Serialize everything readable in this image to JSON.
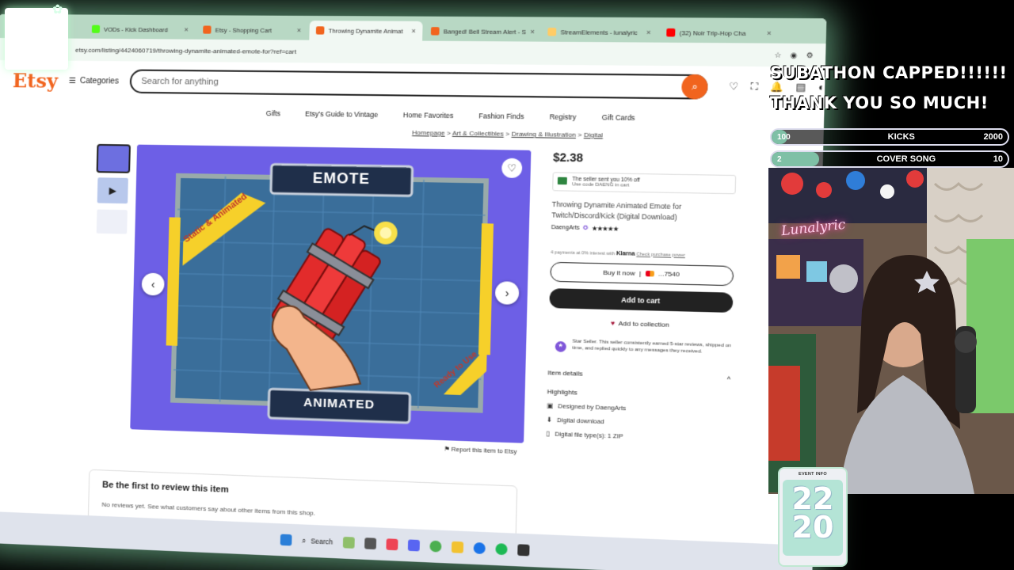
{
  "browser": {
    "tabs": [
      {
        "label": "VODs - Kick Dashboard",
        "color": "#53fc18"
      },
      {
        "label": "Etsy - Shopping Cart",
        "color": "#f1641e"
      },
      {
        "label": "Throwing Dynamite Animat",
        "color": "#f1641e",
        "active": true
      },
      {
        "label": "Banged! Bell Stream Alert - S",
        "color": "#f1641e"
      },
      {
        "label": "StreamElements - lunalyric",
        "color": "#ffcc66"
      },
      {
        "label": "(32) Noir Trip-Hop Cha",
        "color": "#ff0000"
      }
    ],
    "url": "etsy.com/listing/4424060719/throwing-dynamite-animated-emote-for?ref=cart"
  },
  "etsy": {
    "logo": "Etsy",
    "categories": "Categories",
    "search_placeholder": "Search for anything",
    "nav": [
      "Gifts",
      "Etsy's Guide to Vintage",
      "Home Favorites",
      "Fashion Finds",
      "Registry",
      "Gift Cards"
    ],
    "breadcrumbs": [
      "Homepage",
      "Art & Collectibles",
      "Drawing & Illustration",
      "Digital"
    ],
    "hero": {
      "banner_top": "EMOTE",
      "banner_bottom": "ANIMATED",
      "ribbon_left": "Static & Animated",
      "ribbon_right": "Ready to Use"
    },
    "report": "Report this item to Etsy",
    "price": "$2.38",
    "promo_title": "The seller sent you 10% off",
    "promo_sub": "Use code DAENG in cart",
    "title": "Throwing Dynamite Animated Emote for Twitch/Discord/Kick (Digital Download)",
    "shop": "DaengArts",
    "klarna_text": "4 payments at 0% interest with",
    "klarna_brand": "Klarna",
    "klarna_link": "Check purchase power",
    "buy_now": "Buy it now",
    "card_last": "...7540",
    "add_to_cart": "Add to cart",
    "add_collection": "Add to collection",
    "star_seller": "Star Seller. This seller consistently earned 5-star reviews, shipped on time, and replied quickly to any messages they received.",
    "item_details": "Item details",
    "highlights": "Highlights",
    "highlight_items": [
      "Designed by DaengArts",
      "Digital download",
      "Digital file type(s): 1 ZIP"
    ],
    "reviews_title": "Be the first to review this item",
    "reviews_sub": "No reviews yet. See what customers say about other items from this shop."
  },
  "taskbar": {
    "search": "Search"
  },
  "overlay": {
    "line1": "SUBATHON CAPPED!!!!!!",
    "line2": "THANK YOU SO MUCH!",
    "goals": [
      {
        "current": "100",
        "name": "KICKS",
        "max": "2000",
        "progress": 0.05
      },
      {
        "current": "2",
        "name": "COVER SONG",
        "max": "10",
        "progress": 0.2
      }
    ],
    "neon_sign": "Lunalyric",
    "event_header": "EVENT INFO",
    "event_num_top": "22",
    "event_num_bottom": "20"
  },
  "colors": {
    "etsy_orange": "#f1641e",
    "hero_purple": "#6d5fe6",
    "glow": "#a0ffc8"
  }
}
